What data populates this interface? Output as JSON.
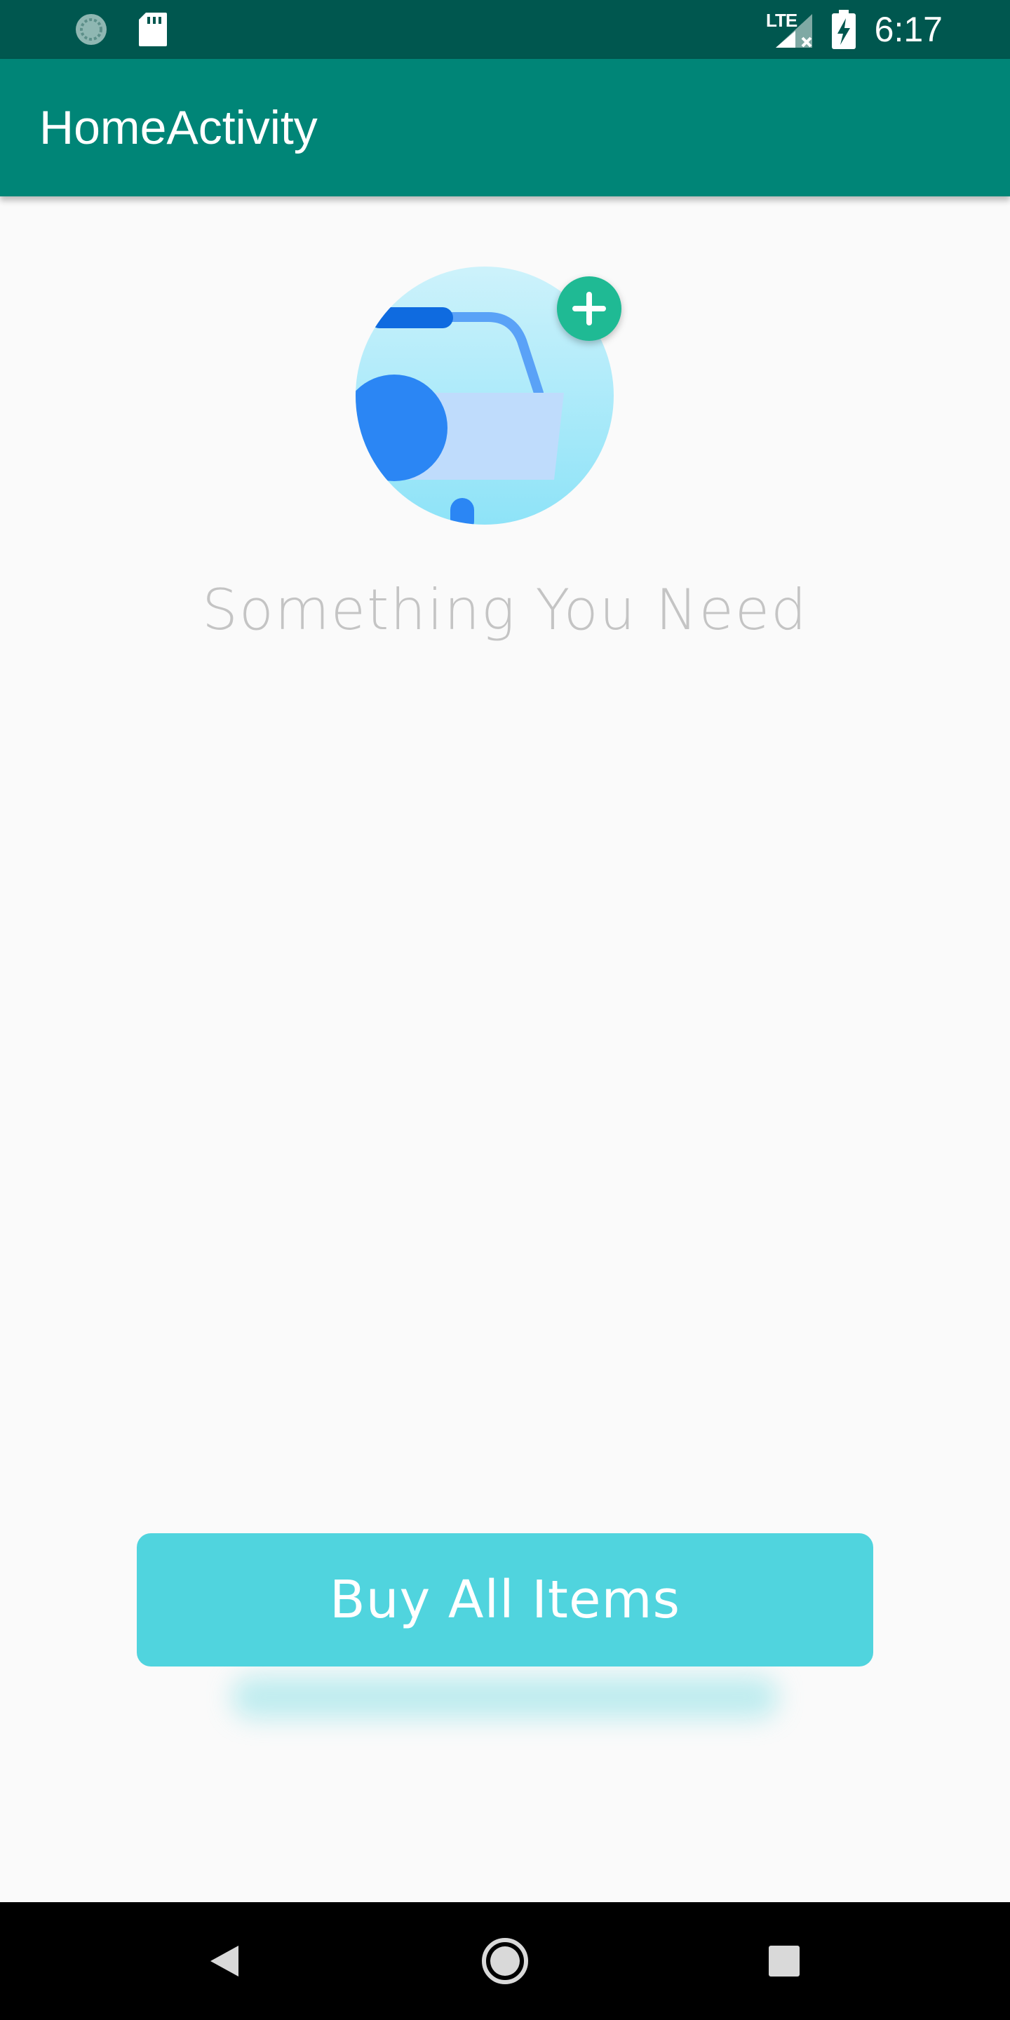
{
  "status_bar": {
    "time": "6:17",
    "network": "LTE",
    "icons": [
      "sync-icon",
      "sd-card-icon",
      "signal-icon",
      "battery-charging-icon"
    ]
  },
  "app_bar": {
    "title": "HomeActivity"
  },
  "empty_state": {
    "illustration": "shopping-basket-add-icon",
    "headline": "Something You Need"
  },
  "actions": {
    "buy_label": "Buy All Items"
  },
  "nav_bar": {
    "icons": [
      "back-icon",
      "home-icon",
      "recents-icon"
    ]
  },
  "colors": {
    "status_bar": "#00574f",
    "app_bar": "#008577",
    "accent_button": "#50d4de",
    "plus_badge": "#1fba94"
  }
}
